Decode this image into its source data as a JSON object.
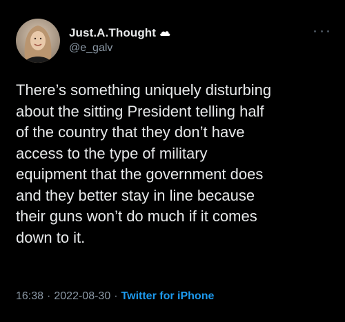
{
  "tweet": {
    "author": {
      "display_name": "Just.A.Thought",
      "handle": "@e_galv",
      "name_emoji_icon": "cloud-emoji-icon"
    },
    "text": "There’s something uniquely disturbing\nabout the sitting President telling half\nof the country that they don’t have\naccess to the type of military\nequipment that the government does\nand they better stay in line because\ntheir guns won’t do much if it comes\ndown to it.",
    "time": "16:38",
    "date": "2022-08-30",
    "separator": "·",
    "source": "Twitter for iPhone",
    "more_icon": "more-options-icon"
  },
  "colors": {
    "background": "#000000",
    "primary_text": "#e7e9ea",
    "secondary_text": "#8b98a5",
    "link": "#1d9bf0"
  }
}
